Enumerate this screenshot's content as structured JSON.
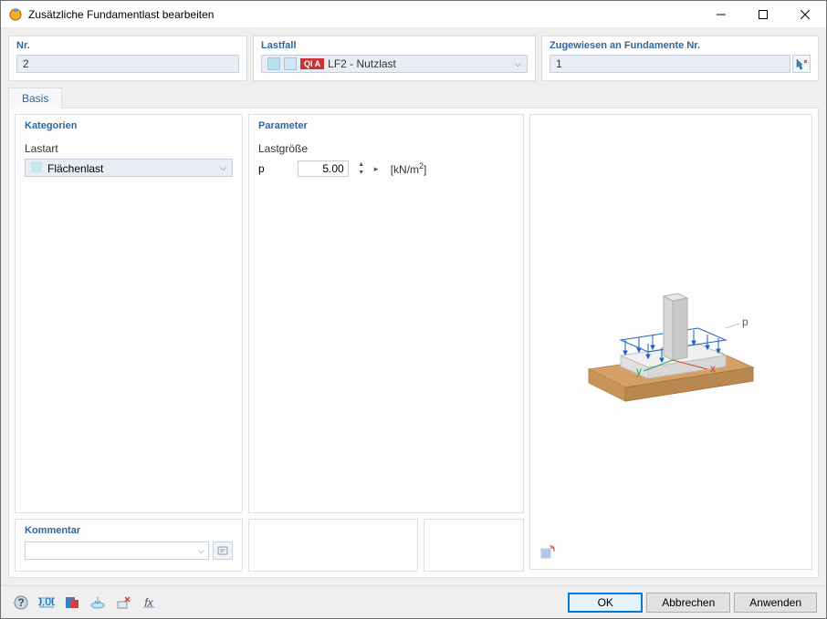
{
  "window": {
    "title": "Zusätzliche Fundamentlast bearbeiten"
  },
  "top": {
    "nr": {
      "label": "Nr.",
      "value": "2"
    },
    "lastfall": {
      "label": "Lastfall",
      "badge": "QI A",
      "value": "LF2 - Nutzlast"
    },
    "zugewiesen": {
      "label": "Zugewiesen an Fundamente Nr.",
      "value": "1"
    }
  },
  "tabs": {
    "basis": "Basis"
  },
  "kategorien": {
    "title": "Kategorien",
    "lastart_label": "Lastart",
    "lastart_value": "Flächenlast"
  },
  "parameter": {
    "title": "Parameter",
    "lastgroesse_label": "Lastgröße",
    "p_symbol": "p",
    "p_value": "5.00",
    "p_unit": "[kN/m²]"
  },
  "kommentar": {
    "title": "Kommentar"
  },
  "preview": {
    "axis_x": "x",
    "axis_y": "y",
    "load_label": "p"
  },
  "footer": {
    "ok": "OK",
    "abbrechen": "Abbrechen",
    "anwenden": "Anwenden"
  }
}
